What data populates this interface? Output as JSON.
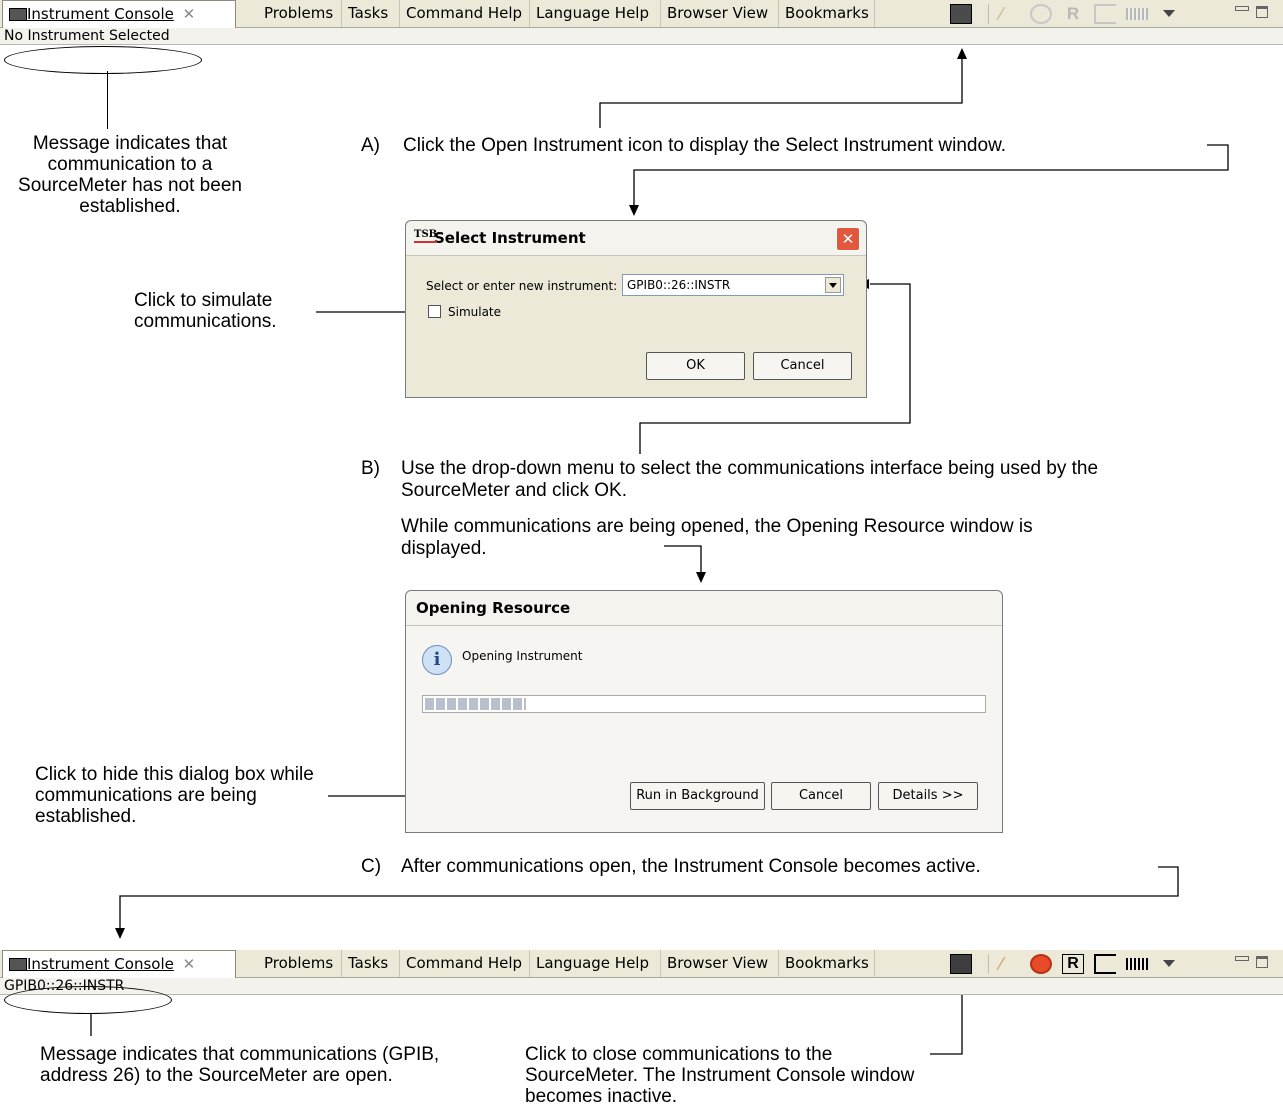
{
  "top_toolbar": {
    "tabs": [
      "Instrument Console",
      "Problems",
      "Tasks",
      "Command Help",
      "Language Help",
      "Browser View",
      "Bookmarks"
    ],
    "status": "No Instrument Selected"
  },
  "bottom_toolbar": {
    "tabs": [
      "Instrument Console",
      "Problems",
      "Tasks",
      "Command Help",
      "Language Help",
      "Browser View",
      "Bookmarks"
    ],
    "status": "GPIB0::26::INSTR"
  },
  "callouts": {
    "no_comm": "Message indicates that communication to a SourceMeter has not been established.",
    "simulate": "Click to simulate communications.",
    "hide_dialog": "Click to hide this dialog box while communications are being established.",
    "comm_open": "Message indicates that communications (GPIB, address 26) to the SourceMeter are open.",
    "close_comm": "Click to close communications to the SourceMeter. The Instrument Console window becomes inactive."
  },
  "steps": {
    "a_letter": "A)",
    "a_text": "Click the Open Instrument icon to display the Select Instrument window.",
    "b_letter": "B)",
    "b_text": "Use the drop-down menu to select the communications interface being used by the SourceMeter and click OK.",
    "b_text2": "While communications are being opened, the Opening Resource window is displayed.",
    "c_letter": "C)",
    "c_text": "After communications open, the Instrument Console becomes active."
  },
  "select_dialog": {
    "logo": "TSB",
    "title": "Select Instrument",
    "field_label": "Select or enter new instrument:",
    "field_value": "GPIB0::26::INSTR",
    "simulate_label": "Simulate",
    "ok": "OK",
    "cancel": "Cancel"
  },
  "opening_dialog": {
    "title": "Opening Resource",
    "message": "Opening Instrument",
    "progress": 0.18,
    "run_bg": "Run in Background",
    "cancel": "Cancel",
    "details": "Details >>"
  },
  "colors": {
    "accent": "#e84b2a",
    "tabbar_bg": "#ece9d8"
  }
}
